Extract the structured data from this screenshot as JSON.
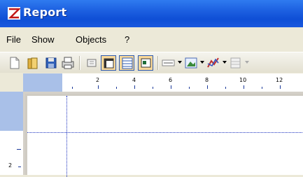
{
  "window": {
    "title": "Report",
    "icon": "report-app-icon"
  },
  "menu": {
    "items": [
      "File",
      "Show",
      "Objects",
      "?"
    ]
  },
  "toolbar": {
    "buttons": [
      "new-icon",
      "open-icon",
      "save-icon",
      "print-icon",
      "page-setup-icon",
      "ruler-icon",
      "grid-icon",
      "zoom-icon",
      "line-tool-icon",
      "image-tool-icon",
      "chart-tool-icon",
      "table-tool-icon"
    ],
    "active_buttons": [
      "ruler-icon",
      "grid-icon",
      "zoom-icon"
    ]
  },
  "ruler": {
    "horizontal_labels": [
      "2",
      "4",
      "6",
      "8",
      "10",
      "12"
    ],
    "vertical_labels": [
      "2"
    ]
  },
  "colors": {
    "titlebar": "#0f4fd6",
    "ruler_highlight": "#a9c0e8",
    "guide": "#1a2fbf",
    "active_button": "#fbd99a"
  }
}
